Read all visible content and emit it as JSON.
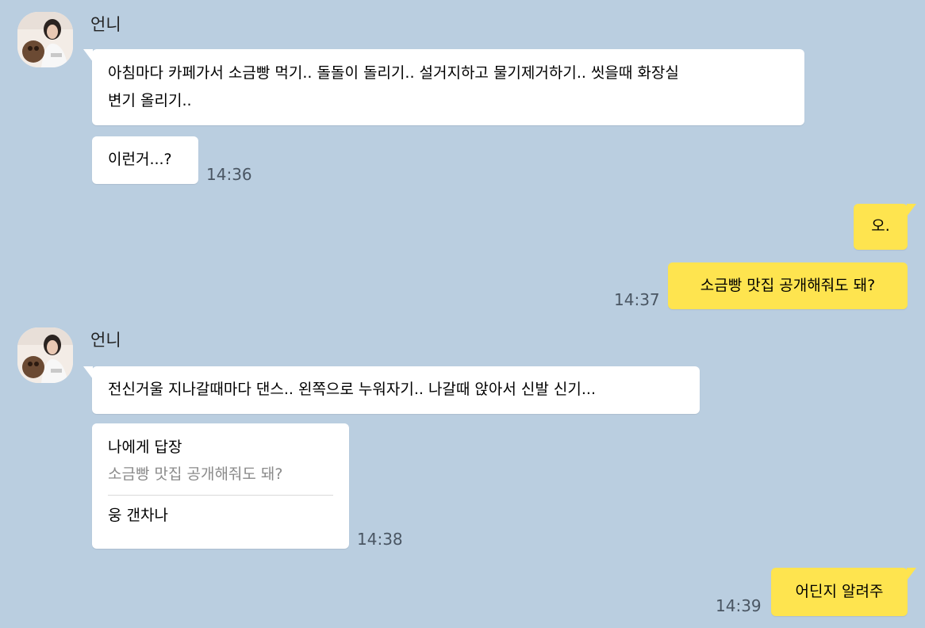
{
  "chat": {
    "messages": [
      {
        "sender": "언니",
        "avatar": "profile-photo-woman-with-dog",
        "line1": "아침마다 카페가서 소금빵 먹기.. 돌돌이 돌리기.. 설거지하고 물기제거하기.. 씻을때 화장실",
        "line2": "변기 올리기.."
      },
      {
        "text": "이런거...?",
        "time": "14:36"
      },
      {
        "text": "오."
      },
      {
        "text": "소금빵 맛집 공개해줘도 돼?",
        "time": "14:37"
      },
      {
        "sender": "언니",
        "avatar": "profile-photo-woman-with-dog",
        "text": "전신거울 지나갈때마다 댄스.. 왼쪽으로 누워자기.. 나갈때 앉아서 신발 신기..."
      },
      {
        "reply_title": "나에게 답장",
        "reply_quote": "소금빵 맛집 공개해줘도 돼?",
        "text": "웅 갠차나",
        "time": "14:38"
      },
      {
        "text": "어딘지 알려주",
        "time": "14:39"
      }
    ]
  },
  "colors": {
    "background": "#bacee0",
    "incoming_bubble": "#ffffff",
    "outgoing_bubble": "#fee44f"
  }
}
